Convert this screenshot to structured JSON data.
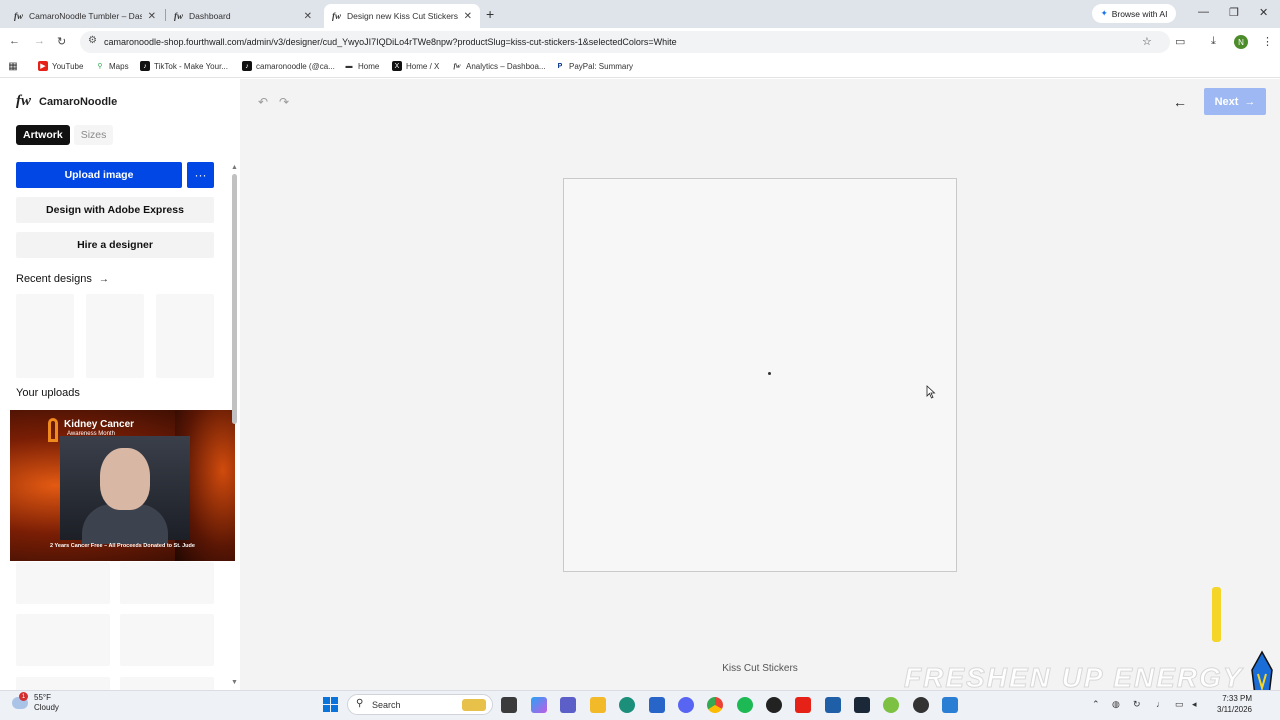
{
  "browser": {
    "tabs": [
      {
        "title": "CamaroNoodle Tumbler – Dash",
        "favicon": "fw"
      },
      {
        "title": "Dashboard",
        "favicon": "fw"
      },
      {
        "title": "Design new Kiss Cut Stickers",
        "favicon": "fw",
        "active": true
      }
    ],
    "browse_ai": "Browse with AI",
    "url": "camaronoodle-shop.fourthwall.com/admin/v3/designer/cud_YwyoJI7IQDiLo4rTWe8npw?productSlug=kiss-cut-stickers-1&selectedColors=White",
    "profile_initial": "N",
    "bookmarks": [
      "YouTube",
      "Maps",
      "TikTok - Make Your...",
      "camaronoodle (@ca...",
      "Home",
      "Home / X",
      "Analytics – Dashboa...",
      "PayPal: Summary"
    ]
  },
  "sidebar": {
    "logo": "fw",
    "shop_name": "CamaroNoodle",
    "tabs": [
      "Artwork",
      "Sizes"
    ],
    "upload_label": "Upload image",
    "more_label": "···",
    "adobe_label": "Design with Adobe Express",
    "hire_label": "Hire a designer",
    "recent_label": "Recent designs",
    "recent_arrow": "→",
    "uploads_label": "Your uploads",
    "upload_item": {
      "title": "Kidney Cancer",
      "subtitle": "Awareness Month",
      "caption": "2 Years Cancer Free – All Proceeds Donated to St. Jude"
    }
  },
  "canvas": {
    "undo": "↶",
    "redo": "↷",
    "back": "←",
    "next_label": "Next",
    "next_arrow": "→",
    "product_label": "Kiss Cut Stickers",
    "overlay_text": "FRESHEN UP ENERGY"
  },
  "taskbar": {
    "weather_temp": "55°F",
    "weather_desc": "Cloudy",
    "weather_badge": "1",
    "search_placeholder": "Search",
    "time": "7:33 PM",
    "date": "3/11/2026"
  },
  "colors": {
    "primary": "#0047e6",
    "next_disabled": "#9db8f3",
    "canvas_bg": "#f3f3f3"
  }
}
